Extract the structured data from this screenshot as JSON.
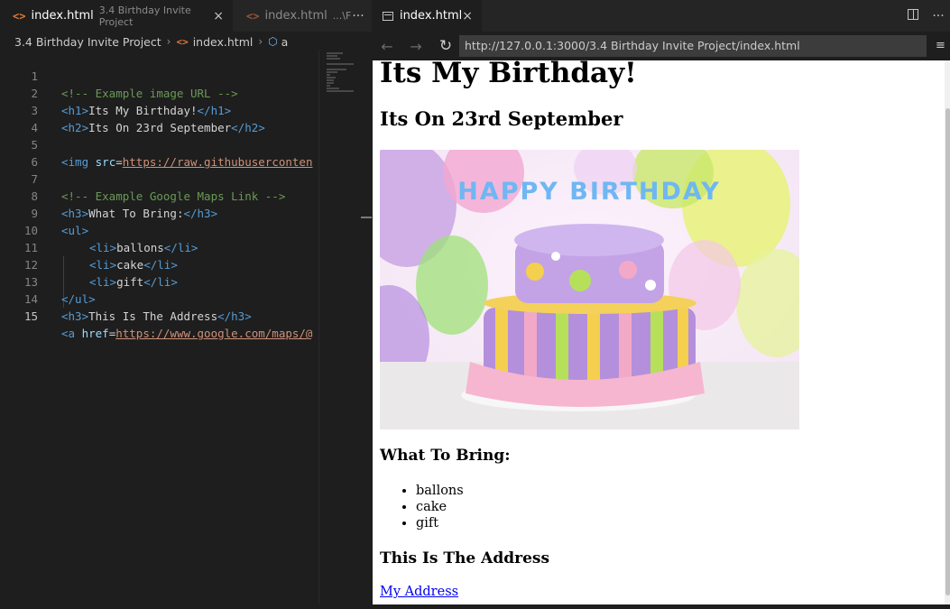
{
  "editor": {
    "tabs": [
      {
        "icon": "<>",
        "label": "index.html",
        "description": "3.4 Birthday Invite Project",
        "close": "×"
      },
      {
        "icon": "<>",
        "label": "index.html",
        "description": "...\\F"
      }
    ],
    "more": "···",
    "breadcrumb": {
      "folder": "3.4 Birthday Invite Project",
      "file": "index.html",
      "symbol": "a"
    },
    "lines": [
      {
        "n": "1"
      },
      {
        "n": "2"
      },
      {
        "n": "3"
      },
      {
        "n": "4"
      },
      {
        "n": "5"
      },
      {
        "n": "6"
      },
      {
        "n": "7"
      },
      {
        "n": "8"
      },
      {
        "n": "9"
      },
      {
        "n": "10"
      },
      {
        "n": "11"
      },
      {
        "n": "12"
      },
      {
        "n": "13"
      },
      {
        "n": "14"
      },
      {
        "n": "15"
      }
    ],
    "code": {
      "l1_comment": "<!-- Example image URL -->",
      "l2_open": "<h1>",
      "l2_text": "Its My Birthday!",
      "l2_close": "</h1>",
      "l3_open": "<h2>",
      "l3_text": "Its On 23rd September",
      "l3_close": "</h2>",
      "l5_open": "<img ",
      "l5_attr": "src",
      "l5_eq": "=",
      "l5_val": "https://raw.githubuserconten",
      "l7_comment": "<!-- Example Google Maps Link -->",
      "l8_open": "<h3>",
      "l8_text": "What To Bring:",
      "l8_close": "</h3>",
      "l9_open": "<ul>",
      "l10_open": "<li>",
      "l10_text": "ballons",
      "l10_close": "</li>",
      "l11_open": "<li>",
      "l11_text": "cake",
      "l11_close": "</li>",
      "l12_open": "<li>",
      "l12_text": "gift",
      "l12_close": "</li>",
      "l13_close": "</ul>",
      "l14_open": "<h3>",
      "l14_text": "This Is The Address",
      "l14_close": "</h3>",
      "l15_open": "<a ",
      "l15_attr": "href",
      "l15_eq": "=",
      "l15_val": "https://www.google.com/maps/@"
    }
  },
  "preview": {
    "tab_label": "index.html",
    "tab_close": "×",
    "more": "···",
    "back": "←",
    "forward": "→",
    "reload": "↻",
    "url": "http://127.0.0.1:3000/3.4 Birthday Invite Project/index.html",
    "menu": "≡",
    "page": {
      "h1": "Its My Birthday!",
      "h2": "Its On 23rd September",
      "cake_text": "HAPPY BIRTHDAY",
      "h3_bring": "What To Bring:",
      "items": [
        "ballons",
        "cake",
        "gift"
      ],
      "h3_address": "This Is The Address",
      "link": "My Address"
    }
  }
}
